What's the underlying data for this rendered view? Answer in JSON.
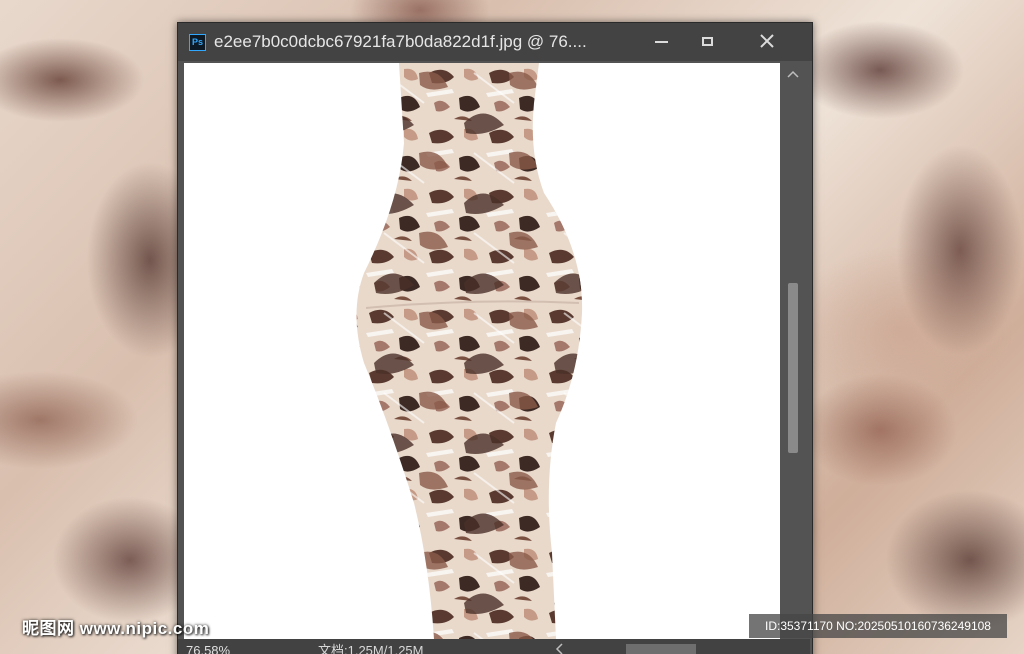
{
  "window": {
    "title": "e2ee7b0c0dcbc67921fa7b0da822d1f.jpg @ 76....",
    "app_icon": "ps-icon",
    "app_icon_label": "Ps"
  },
  "statusbar": {
    "zoom": "76.58%",
    "doc_info": "文档:1.25M/1.25M"
  },
  "watermark": {
    "site": "昵图网 www.nipic.com",
    "id_text": "ID:35371170 NO:20250510160736249108"
  },
  "colors": {
    "ps_accent": "#31a8ff",
    "window_bg": "#535353",
    "titlebar_bg": "#434343"
  }
}
